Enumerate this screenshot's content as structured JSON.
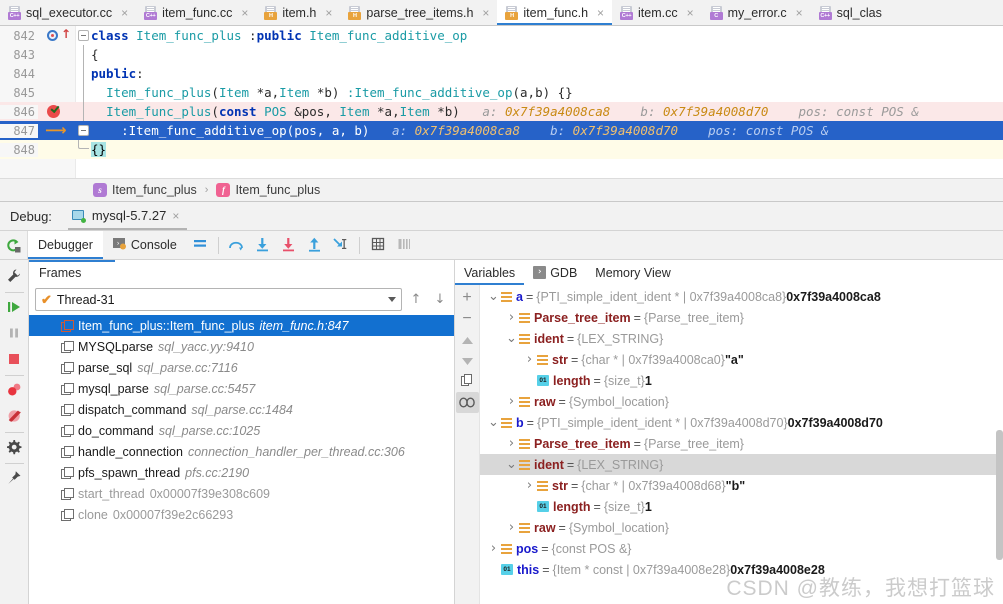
{
  "tabs": [
    {
      "label": "sql_executor.cc",
      "icon": "cpp-file-icon",
      "badge": "C++",
      "active": false
    },
    {
      "label": "item_func.cc",
      "icon": "cpp-file-icon",
      "badge": "C++",
      "active": false
    },
    {
      "label": "item.h",
      "icon": "header-file-icon",
      "badge": "H",
      "active": false
    },
    {
      "label": "parse_tree_items.h",
      "icon": "header-file-icon",
      "badge": "H",
      "active": false
    },
    {
      "label": "item_func.h",
      "icon": "header-file-icon",
      "badge": "H",
      "active": true
    },
    {
      "label": "item.cc",
      "icon": "cpp-file-icon",
      "badge": "C++",
      "active": false
    },
    {
      "label": "my_error.c",
      "icon": "c-file-icon",
      "badge": "C",
      "active": false
    },
    {
      "label": "sql_clas",
      "icon": "cpp-file-icon",
      "badge": "C++",
      "active": false
    }
  ],
  "tab_close_glyph": "×",
  "editor": {
    "lines": [
      {
        "num": "842",
        "gutter": "breakpoint-ring-with-arrow",
        "fold": "fold-collapse",
        "style": "normal",
        "tokens": [
          {
            "t": "class ",
            "c": "kw"
          },
          {
            "t": "Item_func_plus ",
            "c": "ty"
          },
          {
            "t": ":",
            "c": "pl"
          },
          {
            "t": "public ",
            "c": "kw"
          },
          {
            "t": "Item_func_additive_op",
            "c": "ty"
          }
        ]
      },
      {
        "num": "843",
        "gutter": "",
        "fold": "fold-line",
        "style": "normal",
        "tokens": [
          {
            "t": "{",
            "c": "pl"
          }
        ]
      },
      {
        "num": "844",
        "gutter": "",
        "fold": "fold-line",
        "style": "normal",
        "tokens": [
          {
            "t": "public",
            "c": "kw"
          },
          {
            "t": ":",
            "c": "pl"
          }
        ]
      },
      {
        "num": "845",
        "gutter": "",
        "fold": "fold-line",
        "style": "normal",
        "tokens": [
          {
            "t": "  ",
            "c": "pl"
          },
          {
            "t": "Item_func_plus",
            "c": "ty"
          },
          {
            "t": "(",
            "c": "pl"
          },
          {
            "t": "Item ",
            "c": "ty"
          },
          {
            "t": "*a,",
            "c": "pl"
          },
          {
            "t": "Item ",
            "c": "ty"
          },
          {
            "t": "*b) ",
            "c": "pl"
          },
          {
            "t": ":Item_func_additive_op",
            "c": "ty"
          },
          {
            "t": "(a,b) {}",
            "c": "pl"
          }
        ]
      },
      {
        "num": "846",
        "gutter": "breakpoint-verified",
        "fold": "fold-line",
        "style": "hl-bp",
        "tokens": [
          {
            "t": "  ",
            "c": "pl"
          },
          {
            "t": "Item_func_plus",
            "c": "ty"
          },
          {
            "t": "(",
            "c": "pl"
          },
          {
            "t": "const ",
            "c": "kw"
          },
          {
            "t": "POS ",
            "c": "ty"
          },
          {
            "t": "&pos, ",
            "c": "pl"
          },
          {
            "t": "Item ",
            "c": "ty"
          },
          {
            "t": "*a,",
            "c": "pl"
          },
          {
            "t": "Item ",
            "c": "ty"
          },
          {
            "t": "*b)",
            "c": "pl"
          },
          {
            "t": "   a: ",
            "c": "hint"
          },
          {
            "t": "0x7f39a4008ca8",
            "c": "hintv"
          },
          {
            "t": "    b: ",
            "c": "hint"
          },
          {
            "t": "0x7f39a4008d70",
            "c": "hintv"
          },
          {
            "t": "    pos: const POS &",
            "c": "hint"
          }
        ]
      },
      {
        "num": "847",
        "gutter": "execution-pointer",
        "fold": "fold-collapse",
        "style": "hl-exec",
        "tokens": [
          {
            "t": "    :Item_func_additive_op",
            "c": "ty"
          },
          {
            "t": "(pos, a, b)",
            "c": "pl"
          },
          {
            "t": "   a: ",
            "c": "hint"
          },
          {
            "t": "0x7f39a4008ca8",
            "c": "hintv"
          },
          {
            "t": "    b: ",
            "c": "hint"
          },
          {
            "t": "0x7f39a4008d70",
            "c": "hintv"
          },
          {
            "t": "    pos: const POS &",
            "c": "hint"
          }
        ]
      },
      {
        "num": "848",
        "gutter": "",
        "fold": "fold-end",
        "style": "hl-yellow",
        "tokens": [
          {
            "t": "{}",
            "c": "sel-brace"
          }
        ]
      }
    ]
  },
  "breadcrumb": {
    "items": [
      {
        "badge": "s",
        "badge_kind": "class-badge",
        "label": "Item_func_plus"
      },
      {
        "badge": "f",
        "badge_kind": "function-badge",
        "label": "Item_func_plus"
      }
    ],
    "separator": "›"
  },
  "debug_header": {
    "label": "Debug:",
    "session_name": "mysql-5.7.27",
    "session_icon": "run-configuration-icon",
    "close_glyph": "×"
  },
  "debug_toolbar": {
    "rerun_icon": "rerun-icon",
    "tabs": [
      {
        "label": "Debugger",
        "icon": null,
        "active": true
      },
      {
        "label": "Console",
        "icon": "console-icon",
        "active": false
      }
    ],
    "buttons": [
      {
        "name": "layout-settings-icon",
        "glyph": "≡",
        "color": "#2f8fd8"
      },
      {
        "name": "step-over-icon",
        "glyph": "⤴",
        "color": "#3aa0dc"
      },
      {
        "name": "step-into-icon",
        "glyph": "⬇",
        "color": "#3aa0dc"
      },
      {
        "name": "force-step-into-icon",
        "glyph": "⬇",
        "color": "#e8506a"
      },
      {
        "name": "step-out-icon",
        "glyph": "⬆",
        "color": "#3aa0dc"
      },
      {
        "name": "run-to-cursor-icon",
        "glyph": "↘",
        "color": "#3aa0dc"
      },
      {
        "name": "evaluate-expression-icon",
        "glyph": "▦",
        "color": "#5a5a5a"
      },
      {
        "name": "show-threads-icon",
        "glyph": "☷",
        "color": "#aaaaaa"
      }
    ]
  },
  "left_rail": [
    {
      "name": "settings-wrench-icon",
      "glyph": "🔧",
      "color": "#4a4a4a"
    },
    {
      "name": "resume-program-icon",
      "glyph": "▶",
      "color": "#3fa83f"
    },
    {
      "name": "pause-program-icon",
      "glyph": "⏸",
      "color": "#b4b4b4"
    },
    {
      "name": "stop-program-icon",
      "glyph": "■",
      "color": "#e8505a"
    },
    {
      "name": "view-breakpoints-icon",
      "glyph": "●",
      "color": "#e8505a"
    },
    {
      "name": "mute-breakpoints-icon",
      "glyph": "⊘",
      "color": "#e8505a"
    },
    {
      "name": "debug-settings-icon",
      "glyph": "⚙",
      "color": "#4a4a4a"
    },
    {
      "name": "pin-tab-icon",
      "glyph": "📌",
      "color": "#4a4a4a"
    }
  ],
  "frames_panel": {
    "title": "Frames",
    "thread": {
      "label": "Thread-31",
      "status_icon": "thread-running-check-icon"
    },
    "nav": {
      "up": "↑",
      "down": "↓"
    },
    "frames": [
      {
        "fn": "Item_func_plus::Item_func_plus",
        "loc": "item_func.h:847",
        "selected": true,
        "dim": false
      },
      {
        "fn": "MYSQLparse",
        "loc": "sql_yacc.yy:9410",
        "selected": false,
        "dim": false
      },
      {
        "fn": "parse_sql",
        "loc": "sql_parse.cc:7116",
        "selected": false,
        "dim": false
      },
      {
        "fn": "mysql_parse",
        "loc": "sql_parse.cc:5457",
        "selected": false,
        "dim": false
      },
      {
        "fn": "dispatch_command",
        "loc": "sql_parse.cc:1484",
        "selected": false,
        "dim": false
      },
      {
        "fn": "do_command",
        "loc": "sql_parse.cc:1025",
        "selected": false,
        "dim": false
      },
      {
        "fn": "handle_connection",
        "loc": "connection_handler_per_thread.cc:306",
        "selected": false,
        "dim": false
      },
      {
        "fn": "pfs_spawn_thread",
        "loc": "pfs.cc:2190",
        "selected": false,
        "dim": false
      },
      {
        "fn": "start_thread",
        "loc": "0x00007f39e308c609",
        "selected": false,
        "dim": true
      },
      {
        "fn": "clone",
        "loc": "0x00007f39e2c66293",
        "selected": false,
        "dim": true
      }
    ]
  },
  "variables_panel": {
    "tabs": [
      {
        "label": "Variables",
        "icon": null,
        "active": true
      },
      {
        "label": "GDB",
        "icon": "gdb-console-icon",
        "active": false
      },
      {
        "label": "Memory View",
        "icon": null,
        "active": false
      }
    ],
    "rail_buttons": [
      {
        "name": "add-watch-icon",
        "glyph": "+"
      },
      {
        "name": "remove-watch-icon",
        "glyph": "−"
      },
      {
        "name": "move-watch-up-icon",
        "glyph": "▲"
      },
      {
        "name": "move-watch-down-icon",
        "glyph": "▼"
      },
      {
        "name": "copy-value-icon",
        "glyph": "⎘"
      },
      {
        "name": "watches-icon",
        "glyph": "∞",
        "boxed": true
      }
    ],
    "rows": [
      {
        "indent": 0,
        "twisty": "expanded",
        "icon": "struct",
        "name": "a",
        "local": true,
        "type": "{PTI_simple_ident_ident * | 0x7f39a4008ca8}",
        "value": "0x7f39a4008ca8",
        "sel": false
      },
      {
        "indent": 1,
        "twisty": "collapsed",
        "icon": "struct",
        "name": "Parse_tree_item",
        "local": false,
        "type": "{Parse_tree_item}",
        "value": "",
        "sel": false
      },
      {
        "indent": 1,
        "twisty": "expanded",
        "icon": "struct",
        "name": "ident",
        "local": false,
        "type": "{LEX_STRING}",
        "value": "",
        "sel": false
      },
      {
        "indent": 2,
        "twisty": "collapsed",
        "icon": "struct",
        "name": "str",
        "local": false,
        "type": "{char * | 0x7f39a4008ca0}",
        "value": "\"a\"",
        "sel": false
      },
      {
        "indent": 2,
        "twisty": "none",
        "icon": "prim",
        "name": "length",
        "local": false,
        "type": "{size_t}",
        "value": "1",
        "sel": false
      },
      {
        "indent": 1,
        "twisty": "collapsed",
        "icon": "struct",
        "name": "raw",
        "local": false,
        "type": "{Symbol_location}",
        "value": "",
        "sel": false
      },
      {
        "indent": 0,
        "twisty": "expanded",
        "icon": "struct",
        "name": "b",
        "local": true,
        "type": "{PTI_simple_ident_ident * | 0x7f39a4008d70}",
        "value": "0x7f39a4008d70",
        "sel": false
      },
      {
        "indent": 1,
        "twisty": "collapsed",
        "icon": "struct",
        "name": "Parse_tree_item",
        "local": false,
        "type": "{Parse_tree_item}",
        "value": "",
        "sel": false
      },
      {
        "indent": 1,
        "twisty": "expanded",
        "icon": "struct",
        "name": "ident",
        "local": false,
        "type": "{LEX_STRING}",
        "value": "",
        "sel": true
      },
      {
        "indent": 2,
        "twisty": "collapsed",
        "icon": "struct",
        "name": "str",
        "local": false,
        "type": "{char * | 0x7f39a4008d68}",
        "value": "\"b\"",
        "sel": false
      },
      {
        "indent": 2,
        "twisty": "none",
        "icon": "prim",
        "name": "length",
        "local": false,
        "type": "{size_t}",
        "value": "1",
        "sel": false
      },
      {
        "indent": 1,
        "twisty": "collapsed",
        "icon": "struct",
        "name": "raw",
        "local": false,
        "type": "{Symbol_location}",
        "value": "",
        "sel": false
      },
      {
        "indent": 0,
        "twisty": "collapsed",
        "icon": "struct",
        "name": "pos",
        "local": true,
        "type": "{const POS &}",
        "value": "",
        "sel": false
      },
      {
        "indent": 0,
        "twisty": "none",
        "icon": "prim",
        "name": "this",
        "local": true,
        "type": "{Item * const | 0x7f39a4008e28}",
        "value": "0x7f39a4008e28",
        "sel": false
      }
    ],
    "prim_icon_label": "01"
  },
  "watermark": "CSDN @教练，我想打篮球",
  "colors": {
    "accent_blue": "#2f7fd1",
    "selection_blue": "#1270d0",
    "exec_line_blue": "#2662c8",
    "breakpoint_red": "#ea4a4a",
    "breakpoint_line_pink": "#fbe8e8",
    "hint_gray": "#9a9a9a",
    "hint_value_orange": "#c98a14",
    "var_name_red": "#8b2020",
    "var_local_blue": "#1a1acc",
    "struct_icon_orange": "#e8a33d",
    "prim_icon_cyan": "#56d0e8",
    "panel_bg": "#f2f2f2"
  }
}
